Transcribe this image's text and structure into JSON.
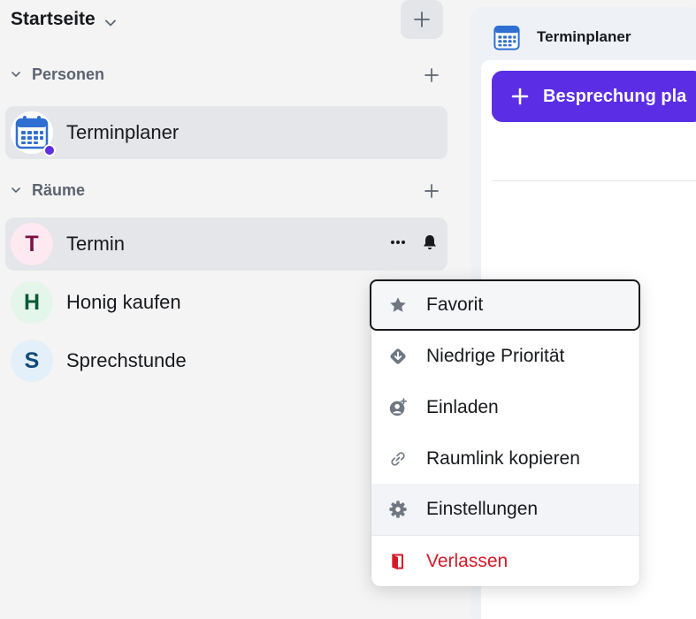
{
  "sidebar": {
    "title": "Startseite",
    "sections": {
      "people": {
        "label": "Personen"
      },
      "rooms": {
        "label": "Räume"
      }
    },
    "people": [
      {
        "label": "Terminplaner"
      }
    ],
    "rooms": [
      {
        "label": "Termin",
        "avatar": "T",
        "color": "#7a1146",
        "bg": "#fde9ef"
      },
      {
        "label": "Honig kaufen",
        "avatar": "H",
        "color": "#0b5a35",
        "bg": "#e4f5ea"
      },
      {
        "label": "Sprechstunde",
        "avatar": "S",
        "color": "#0f4a78",
        "bg": "#e3f0fa"
      }
    ]
  },
  "panel": {
    "title": "Terminplaner",
    "button_label": "Besprechung pla"
  },
  "menu": {
    "items": [
      {
        "label": "Favorit",
        "icon": "star-icon"
      },
      {
        "label": "Niedrige Priorität",
        "icon": "low-priority-icon"
      },
      {
        "label": "Einladen",
        "icon": "invite-user-icon"
      },
      {
        "label": "Raumlink kopieren",
        "icon": "link-icon"
      },
      {
        "label": "Einstellungen",
        "icon": "gear-icon"
      },
      {
        "label": "Verlassen",
        "icon": "leave-door-icon"
      }
    ]
  },
  "colors": {
    "accent": "#5b2ee6",
    "danger": "#d51928",
    "presence": "#5e2ee0"
  }
}
